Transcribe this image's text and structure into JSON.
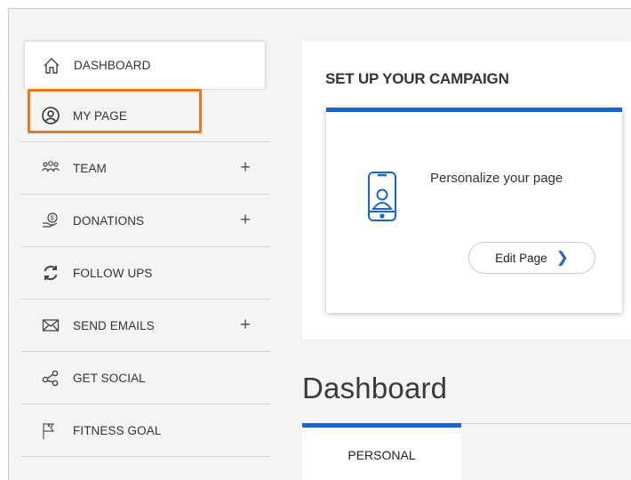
{
  "sidebar": {
    "items": [
      {
        "label": "DASHBOARD",
        "icon": "home-icon"
      },
      {
        "label": "MY PAGE",
        "icon": "user-circle-icon"
      },
      {
        "label": "TEAM",
        "icon": "team-icon",
        "expand": "+"
      },
      {
        "label": "DONATIONS",
        "icon": "donation-icon",
        "expand": "+"
      },
      {
        "label": "FOLLOW UPS",
        "icon": "refresh-icon"
      },
      {
        "label": "SEND EMAILS",
        "icon": "envelope-icon",
        "expand": "+"
      },
      {
        "label": "GET SOCIAL",
        "icon": "share-icon"
      },
      {
        "label": "FITNESS GOAL",
        "icon": "flag-icon"
      }
    ]
  },
  "campaign": {
    "title": "SET UP YOUR CAMPAIGN",
    "card_text": "Personalize your page",
    "button_label": "Edit Page",
    "button_icon": "chevron-right-icon"
  },
  "dashboard": {
    "title": "Dashboard",
    "tab_label": "PERSONAL"
  },
  "colors": {
    "accent": "#1b66c9",
    "highlight": "#e8761d"
  }
}
